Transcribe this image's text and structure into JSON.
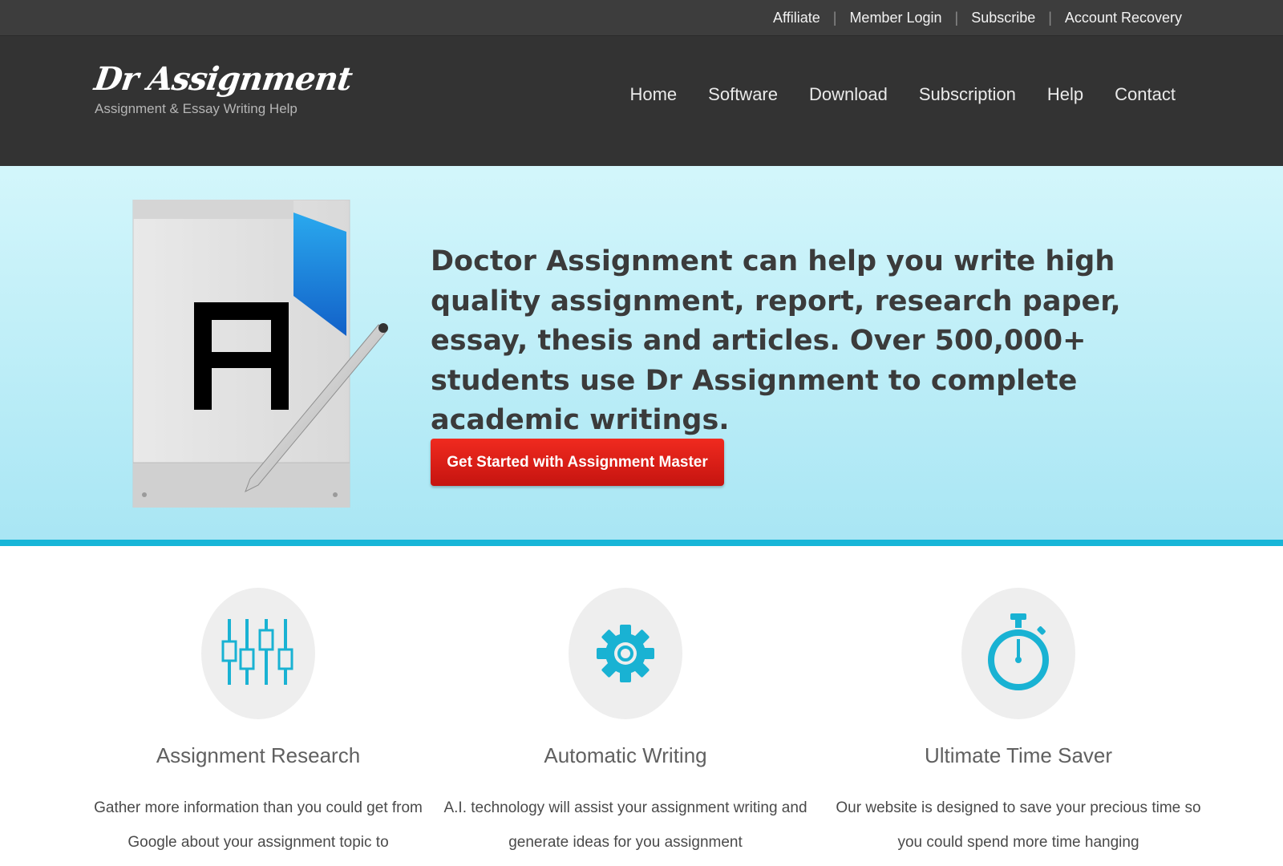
{
  "topbar": {
    "links": [
      "Affiliate",
      "Member Login",
      "Subscribe",
      "Account Recovery"
    ],
    "separator": "|"
  },
  "header": {
    "logo_title": "Dr Assignment",
    "logo_subtitle": "Assignment & Essay Writing Help",
    "nav": [
      "Home",
      "Software",
      "Download",
      "Subscription",
      "Help",
      "Contact"
    ]
  },
  "hero": {
    "icon_letter": "A",
    "headline": "Doctor Assignment can help you write high quality assignment, report, research paper, essay, thesis and articles. Over 500,000+ students use Dr Assignment to complete academic writings.",
    "cta_label": "Get Started with Assignment Master"
  },
  "features": [
    {
      "icon": "sliders-icon",
      "title": "Assignment Research",
      "text": "Gather more information than you could get from Google about your assignment topic to"
    },
    {
      "icon": "gear-icon",
      "title": "Automatic Writing",
      "text": "A.I. technology will assist your assignment writing and generate ideas for you assignment"
    },
    {
      "icon": "stopwatch-icon",
      "title": "Ultimate Time Saver",
      "text": "Our website is designed to save your precious time so you could spend more time hanging"
    }
  ],
  "colors": {
    "topbar_bg": "#3d3d3d",
    "header_bg": "#333333",
    "hero_gradient_top": "#d3f6fb",
    "hero_gradient_bottom": "#a9e6f4",
    "accent_cyan": "#18b6d8",
    "cta_red": "#e0201a"
  }
}
